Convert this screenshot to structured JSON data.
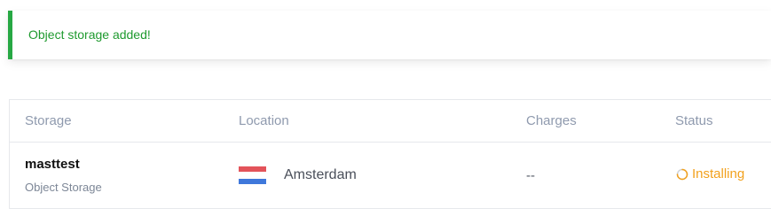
{
  "alert": {
    "message": "Object storage added!",
    "color": "#27a844"
  },
  "table": {
    "headers": {
      "storage": "Storage",
      "location": "Location",
      "charges": "Charges",
      "status": "Status"
    },
    "rows": [
      {
        "name": "masttest",
        "type": "Object Storage",
        "location": "Amsterdam",
        "location_flag": "netherlands-flag-icon",
        "charges": "--",
        "status": "Installing",
        "status_icon": "spinner-icon",
        "status_color": "#f2a11d"
      }
    ]
  }
}
